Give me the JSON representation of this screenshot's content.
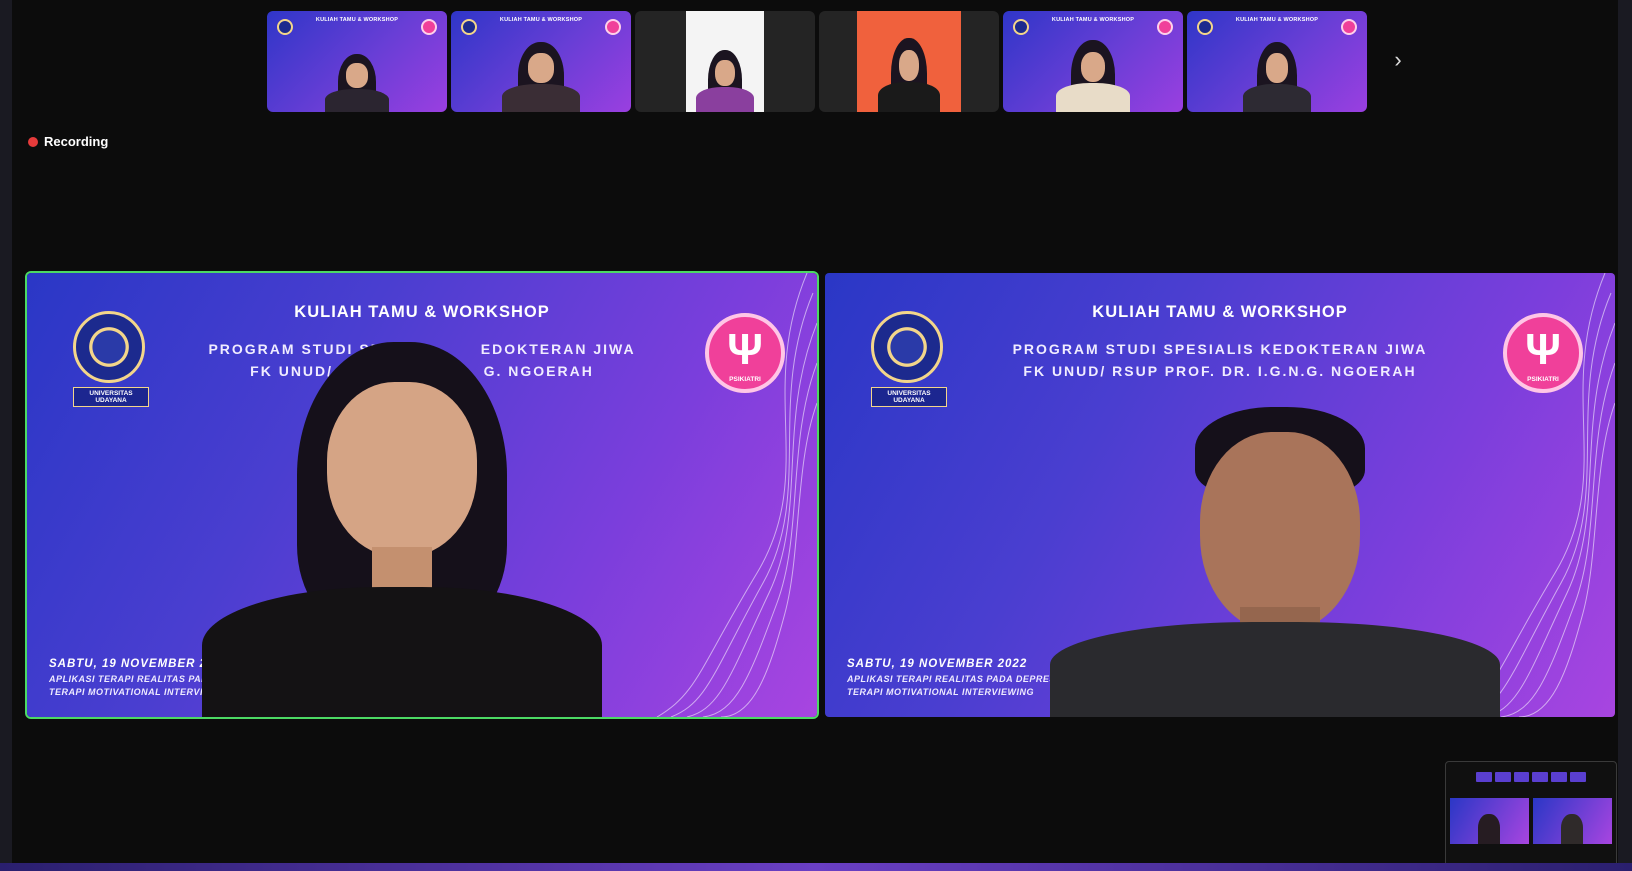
{
  "app": {
    "recording_label": "Recording"
  },
  "slide": {
    "title": "KULIAH TAMU & WORKSHOP",
    "program": "PROGRAM STUDI SPESIALIS KEDOKTERAN JIWA",
    "institution": "FK UNUD/ RSUP PROF. DR. I.G.N.G. NGOERAH",
    "date": "SABTU, 19 NOVEMBER 2022",
    "topic1": "APLIKASI TERAPI REALITAS PADA DEPRESI",
    "topic2": "TERAPI MOTIVATIONAL INTERVIEWING",
    "university_logo_text": "UNIVERSITAS UDAYANA",
    "badge_text": "PSIKIATRI",
    "partial_program_left": "PROGRAM STUDI SPESIAL",
    "partial_program_right": "EDOKTERAN JIWA",
    "partial_institution_left": "FK UNUD/ RSUP PRO",
    "partial_institution_right": "G. NGOERAH",
    "partial_date_left": "SABTU, 19 NOVEMBER 2",
    "partial_topic1_left": "APLIKASI TERAPI REALITAS PADA",
    "partial_topic2_left": "TERAPI MOTIVATIONAL INTERVIE"
  },
  "participants_strip": [
    {
      "kind": "slide"
    },
    {
      "kind": "slide"
    },
    {
      "kind": "video",
      "bg": "#f4f4f4"
    },
    {
      "kind": "video",
      "bg": "#f0613d"
    },
    {
      "kind": "slide"
    },
    {
      "kind": "slide"
    }
  ],
  "colors": {
    "active_speaker_border": "#4cd964",
    "recording_dot": "#e63b3b",
    "slide_gradient_start": "#2a37c6",
    "slide_gradient_end": "#a845e0"
  },
  "icons": {
    "next": "chevron-right-icon",
    "badge": "psi"
  }
}
